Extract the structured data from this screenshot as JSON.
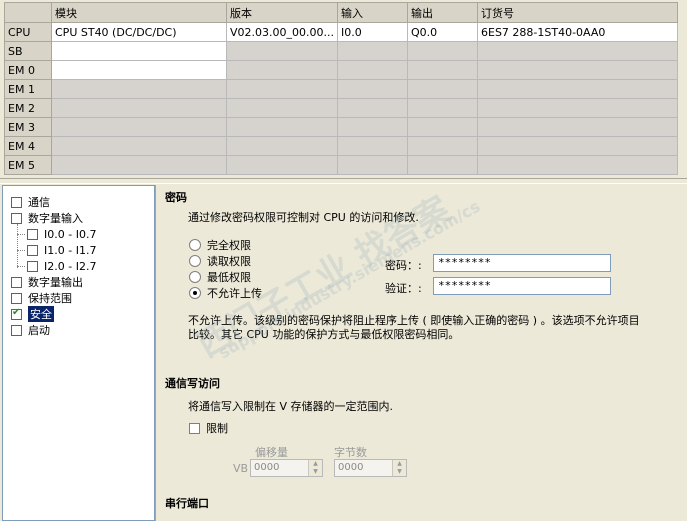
{
  "table": {
    "headers": [
      "",
      "模块",
      "版本",
      "输入",
      "输出",
      "订货号"
    ],
    "rows": [
      {
        "label": "CPU",
        "module": "CPU ST40 (DC/DC/DC)",
        "version": "V02.03.00_00.00...",
        "input": "I0.0",
        "output": "Q0.0",
        "order": "6ES7 288-1ST40-0AA0"
      },
      {
        "label": "SB",
        "module": "",
        "version": "",
        "input": "",
        "output": "",
        "order": ""
      },
      {
        "label": "EM 0",
        "module": "",
        "version": "",
        "input": "",
        "output": "",
        "order": ""
      },
      {
        "label": "EM 1",
        "module": "",
        "version": "",
        "input": "",
        "output": "",
        "order": ""
      },
      {
        "label": "EM 2",
        "module": "",
        "version": "",
        "input": "",
        "output": "",
        "order": ""
      },
      {
        "label": "EM 3",
        "module": "",
        "version": "",
        "input": "",
        "output": "",
        "order": ""
      },
      {
        "label": "EM 4",
        "module": "",
        "version": "",
        "input": "",
        "output": "",
        "order": ""
      },
      {
        "label": "EM 5",
        "module": "",
        "version": "",
        "input": "",
        "output": "",
        "order": ""
      }
    ]
  },
  "tree": {
    "items": [
      "通信",
      "数字量输入",
      "I0.0 - I0.7",
      "I1.0 - I1.7",
      "I2.0 - I2.7",
      "数字量输出",
      "保持范围",
      "安全",
      "启动"
    ]
  },
  "security": {
    "title": "密码",
    "description": "通过修改密码权限可控制对 CPU 的访问和修改.",
    "options": [
      "完全权限",
      "读取权限",
      "最低权限",
      "不允许上传"
    ],
    "selected": "不允许上传",
    "password_label": "密码：:",
    "password_value": "********",
    "verify_label": "验证：:",
    "verify_value": "********",
    "note_line1": "不允许上传。该级别的密码保护将阻止程序上传 ( 即使输入正确的密码 ) 。该选项不允许项目",
    "note_line2": "比较。其它 CPU 功能的保护方式与最低权限密码相同。"
  },
  "comm_write": {
    "title": "通信写访问",
    "description": "将通信写入限制在 V 存储器的一定范围内.",
    "limit_label": "限制",
    "offset_label": "偏移量",
    "bytes_label": "字节数",
    "vb_label": "VB",
    "offset_value": "0000",
    "bytes_value": "0000"
  },
  "serial": {
    "title": "串行端口"
  },
  "watermark": {
    "line1": "西门子工业  找答案",
    "line2": "support.industry.siemens.com/cs"
  }
}
